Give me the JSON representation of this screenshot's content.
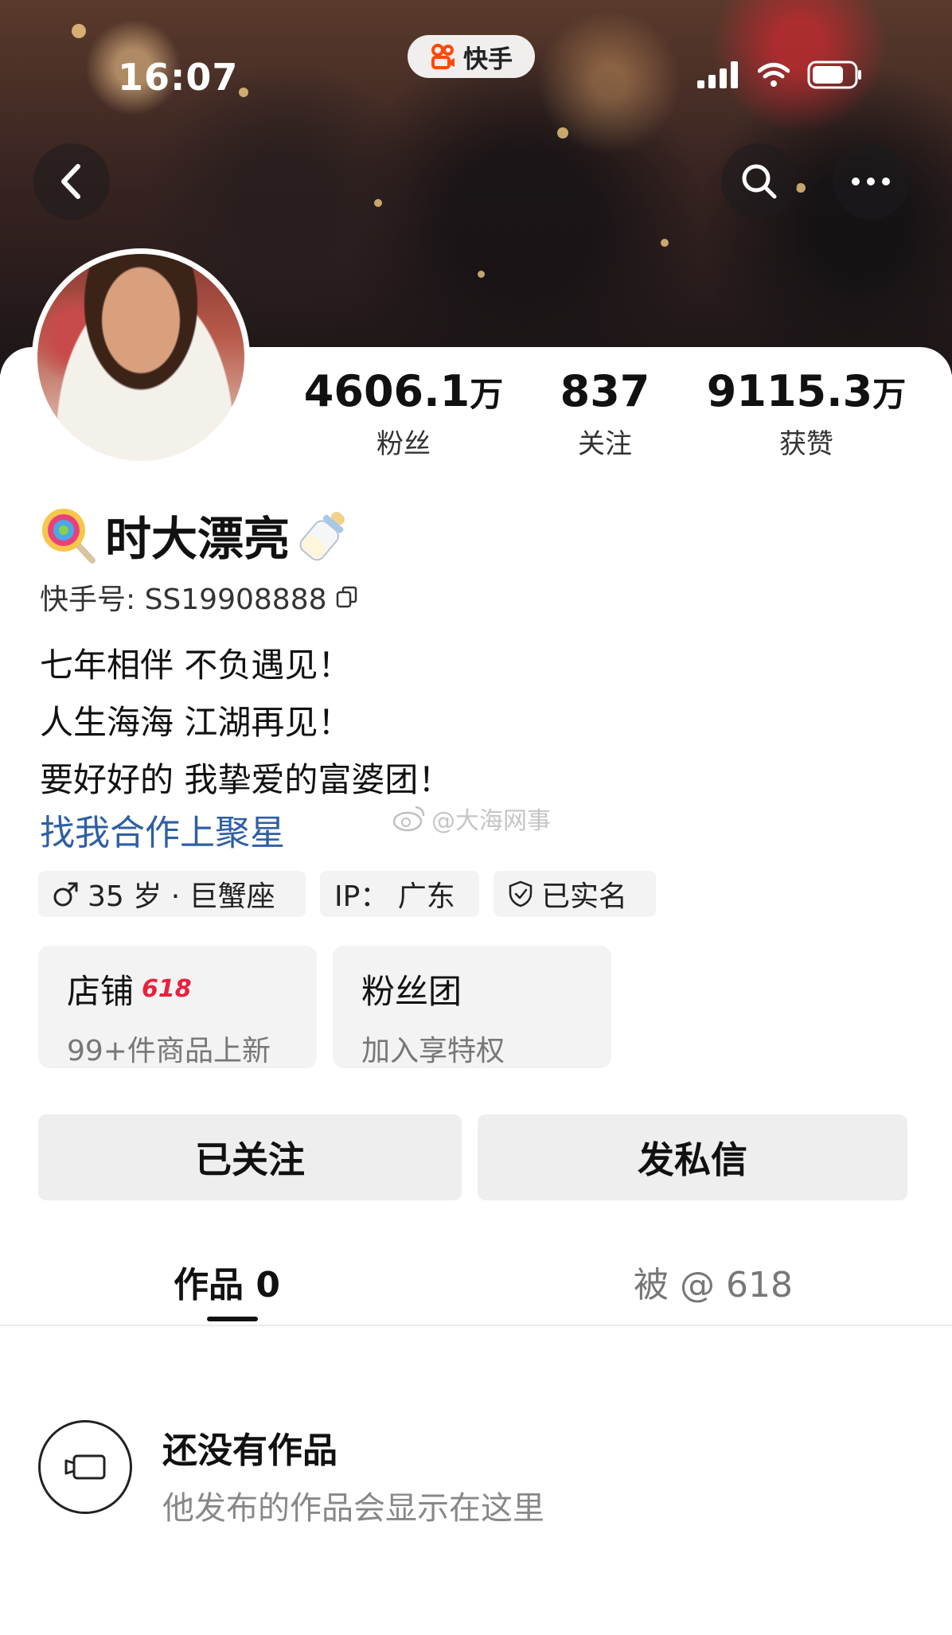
{
  "status_bar": {
    "time": "16:07"
  },
  "app": {
    "name": "快手"
  },
  "profile": {
    "stats": [
      {
        "value": "4606.1",
        "unit": "万",
        "label": "粉丝"
      },
      {
        "value": "837",
        "unit": "",
        "label": "关注"
      },
      {
        "value": "9115.3",
        "unit": "万",
        "label": "获赞"
      }
    ],
    "name": "时大漂亮",
    "kuaishou_id": "快手号: SS19908888",
    "bio": [
      "七年相伴 不负遇见！",
      "人生海海 江湖再见！",
      "要好好的 我挚爱的富婆团！"
    ],
    "bio_link": "找我合作上聚星",
    "tags": [
      "35 岁 · 巨蟹座",
      "IP：  广东",
      "已实名"
    ]
  },
  "cards": [
    {
      "title": "店铺",
      "badge": "618",
      "subtitle": "99+件商品上新"
    },
    {
      "title": "粉丝团",
      "badge": "",
      "subtitle": "加入享特权"
    }
  ],
  "actions": {
    "follow": "已关注",
    "message": "发私信"
  },
  "tabs": [
    {
      "label": "作品 0",
      "active": true
    },
    {
      "label": "被 @ 618",
      "active": false
    }
  ],
  "empty_state": {
    "title": "还没有作品",
    "subtitle": "他发布的作品会显示在这里"
  },
  "watermark": "@大海网事",
  "icons": [
    "back-icon",
    "search-icon",
    "more-icon",
    "copy-icon",
    "gender-male-icon",
    "verified-shield-icon",
    "video-icon",
    "weibo-icon"
  ],
  "colors": {
    "link": "#2f5fa4",
    "badge": "#e8213b",
    "button_bg": "#eeeeee",
    "tag_bg": "#f3f3f3"
  }
}
